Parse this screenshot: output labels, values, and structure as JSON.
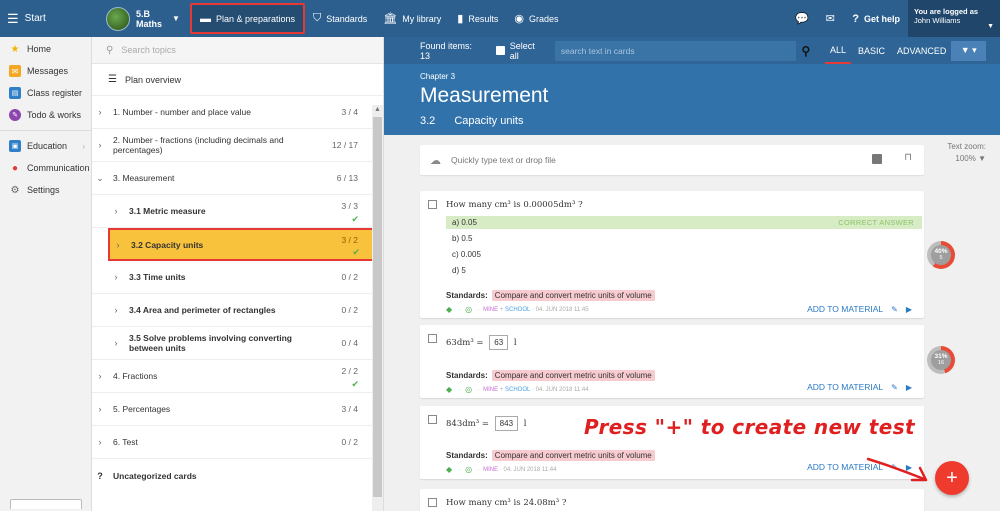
{
  "topbar": {
    "start": "Start",
    "class_line1": "5.B",
    "class_line2": "Maths",
    "nav": [
      {
        "label": "Plan & preparations",
        "icon": "calendar-icon"
      },
      {
        "label": "Standards",
        "icon": "shield-icon"
      },
      {
        "label": "My library",
        "icon": "library-icon"
      },
      {
        "label": "Results",
        "icon": "bar-chart-icon"
      },
      {
        "label": "Grades",
        "icon": "grades-icon"
      }
    ],
    "get_help": "Get help",
    "logged_line1": "You are logged as",
    "logged_line2": "John Williams"
  },
  "leftnav": {
    "items": [
      {
        "label": "Home",
        "icon": "star-icon"
      },
      {
        "label": "Messages",
        "icon": "envelope-icon"
      },
      {
        "label": "Class register",
        "icon": "register-icon"
      },
      {
        "label": "Todo & works",
        "icon": "todo-icon"
      },
      {
        "label": "Education",
        "icon": "education-icon"
      },
      {
        "label": "Communication",
        "icon": "communication-icon"
      },
      {
        "label": "Settings",
        "icon": "gear-icon"
      }
    ]
  },
  "topics": {
    "search_placeholder": "Search topics",
    "plan_overview": "Plan overview",
    "items": [
      {
        "label": "1. Number - number and place value",
        "count": "3 / 4"
      },
      {
        "label": "2. Number - fractions (including decimals and percentages)",
        "count": "12 / 17"
      },
      {
        "label": "3. Measurement",
        "count": "6 / 13"
      },
      {
        "label": "3.1 Metric measure",
        "count": "3 / 3"
      },
      {
        "label": "3.2 Capacity units",
        "count": "3 / 2"
      },
      {
        "label": "3.3 Time units",
        "count": "0 / 2"
      },
      {
        "label": "3.4 Area and perimeter of rectangles",
        "count": "0 / 2"
      },
      {
        "label": "3.5 Solve problems involving converting between units",
        "count": "0 / 4"
      },
      {
        "label": "4. Fractions",
        "count": "2 / 2"
      },
      {
        "label": "5. Percentages",
        "count": "3 / 4"
      },
      {
        "label": "6. Test",
        "count": "0 / 2"
      },
      {
        "label": "Uncategorized cards",
        "count": ""
      }
    ]
  },
  "content": {
    "found_items": "Found items: 13",
    "select_all": "Select all",
    "search_placeholder": "search text in cards",
    "filters": [
      "ALL",
      "BASIC",
      "ADVANCED"
    ],
    "chapter_label": "Chapter 3",
    "chapter_title": "Measurement",
    "sub_num": "3.2",
    "sub_title": "Capacity units",
    "quick_placeholder": "Quickly type text or drop file",
    "zoom_label": "Text zoom:",
    "zoom_value": "100%",
    "standards_label": "Standards:",
    "standard_text": "Compare and convert metric units of volume",
    "add_material": "ADD TO MATERIAL",
    "card1": {
      "question": "How many cm³ is 0.00005dm³ ?",
      "answers": [
        "a) 0.05",
        "b) 0.5",
        "c) 0.005",
        "d) 5"
      ],
      "correct_label": "CORRECT ANSWER",
      "meta_mine": "MINE",
      "meta_school": "SCHOOL",
      "meta_date": "04. JUN 2018 11:45",
      "badge_pct": "40%",
      "badge_sub": "5"
    },
    "card2": {
      "lhs": "63dm³ =",
      "value": "63",
      "unit": "l",
      "meta_mine": "MINE",
      "meta_school": "SCHOOL",
      "meta_date": "04. JUN 2018 11:44",
      "badge_pct": "31%",
      "badge_sub": "16"
    },
    "card3": {
      "lhs": "843dm³ =",
      "value": "843",
      "unit": "l",
      "meta_mine": "MINE",
      "meta_date": "04. JUN 2018 11:44"
    },
    "card4": {
      "question": "How many cm³ is 24.08m³ ?"
    },
    "annotation": "Press \"+\" to create new test",
    "fab": "+"
  }
}
